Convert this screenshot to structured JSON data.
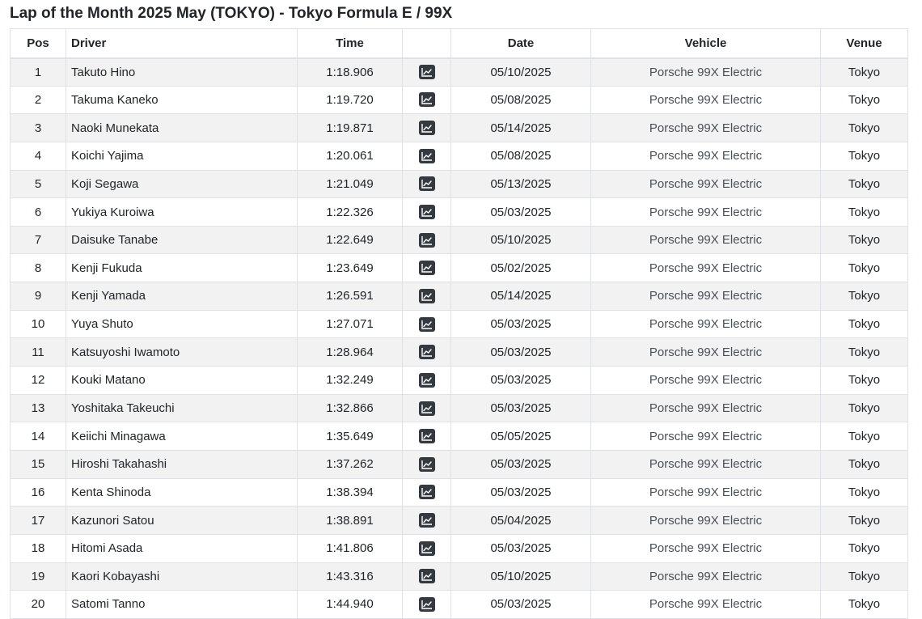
{
  "page": {
    "title": "Lap of the Month 2025 May (TOKYO) - Tokyo Formula E / 99X"
  },
  "table": {
    "headers": {
      "pos": "Pos",
      "driver": "Driver",
      "time": "Time",
      "chart": "",
      "date": "Date",
      "vehicle": "Vehicle",
      "venue": "Venue"
    },
    "rows": [
      {
        "pos": "1",
        "driver": "Takuto Hino",
        "time": "1:18.906",
        "date": "05/10/2025",
        "vehicle": "Porsche 99X Electric",
        "venue": "Tokyo"
      },
      {
        "pos": "2",
        "driver": "Takuma Kaneko",
        "time": "1:19.720",
        "date": "05/08/2025",
        "vehicle": "Porsche 99X Electric",
        "venue": "Tokyo"
      },
      {
        "pos": "3",
        "driver": "Naoki Munekata",
        "time": "1:19.871",
        "date": "05/14/2025",
        "vehicle": "Porsche 99X Electric",
        "venue": "Tokyo"
      },
      {
        "pos": "4",
        "driver": "Koichi Yajima",
        "time": "1:20.061",
        "date": "05/08/2025",
        "vehicle": "Porsche 99X Electric",
        "venue": "Tokyo"
      },
      {
        "pos": "5",
        "driver": "Koji Segawa",
        "time": "1:21.049",
        "date": "05/13/2025",
        "vehicle": "Porsche 99X Electric",
        "venue": "Tokyo"
      },
      {
        "pos": "6",
        "driver": "Yukiya Kuroiwa",
        "time": "1:22.326",
        "date": "05/03/2025",
        "vehicle": "Porsche 99X Electric",
        "venue": "Tokyo"
      },
      {
        "pos": "7",
        "driver": "Daisuke Tanabe",
        "time": "1:22.649",
        "date": "05/10/2025",
        "vehicle": "Porsche 99X Electric",
        "venue": "Tokyo"
      },
      {
        "pos": "8",
        "driver": "Kenji Fukuda",
        "time": "1:23.649",
        "date": "05/02/2025",
        "vehicle": "Porsche 99X Electric",
        "venue": "Tokyo"
      },
      {
        "pos": "9",
        "driver": "Kenji Yamada",
        "time": "1:26.591",
        "date": "05/14/2025",
        "vehicle": "Porsche 99X Electric",
        "venue": "Tokyo"
      },
      {
        "pos": "10",
        "driver": "Yuya Shuto",
        "time": "1:27.071",
        "date": "05/03/2025",
        "vehicle": "Porsche 99X Electric",
        "venue": "Tokyo"
      },
      {
        "pos": "11",
        "driver": "Katsuyoshi Iwamoto",
        "time": "1:28.964",
        "date": "05/03/2025",
        "vehicle": "Porsche 99X Electric",
        "venue": "Tokyo"
      },
      {
        "pos": "12",
        "driver": "Kouki Matano",
        "time": "1:32.249",
        "date": "05/03/2025",
        "vehicle": "Porsche 99X Electric",
        "venue": "Tokyo"
      },
      {
        "pos": "13",
        "driver": "Yoshitaka Takeuchi",
        "time": "1:32.866",
        "date": "05/03/2025",
        "vehicle": "Porsche 99X Electric",
        "venue": "Tokyo"
      },
      {
        "pos": "14",
        "driver": "Keiichi Minagawa",
        "time": "1:35.649",
        "date": "05/05/2025",
        "vehicle": "Porsche 99X Electric",
        "venue": "Tokyo"
      },
      {
        "pos": "15",
        "driver": "Hiroshi Takahashi",
        "time": "1:37.262",
        "date": "05/03/2025",
        "vehicle": "Porsche 99X Electric",
        "venue": "Tokyo"
      },
      {
        "pos": "16",
        "driver": "Kenta Shinoda",
        "time": "1:38.394",
        "date": "05/03/2025",
        "vehicle": "Porsche 99X Electric",
        "venue": "Tokyo"
      },
      {
        "pos": "17",
        "driver": "Kazunori Satou",
        "time": "1:38.891",
        "date": "05/04/2025",
        "vehicle": "Porsche 99X Electric",
        "venue": "Tokyo"
      },
      {
        "pos": "18",
        "driver": "Hitomi Asada",
        "time": "1:41.806",
        "date": "05/03/2025",
        "vehicle": "Porsche 99X Electric",
        "venue": "Tokyo"
      },
      {
        "pos": "19",
        "driver": "Kaori Kobayashi",
        "time": "1:43.316",
        "date": "05/10/2025",
        "vehicle": "Porsche 99X Electric",
        "venue": "Tokyo"
      },
      {
        "pos": "20",
        "driver": "Satomi Tanno",
        "time": "1:44.940",
        "date": "05/03/2025",
        "vehicle": "Porsche 99X Electric",
        "venue": "Tokyo"
      }
    ],
    "row_action_icon": "line-chart-icon"
  },
  "colors": {
    "text": "#212529",
    "vehicle_text": "#495057",
    "stripe": "#f2f2f2",
    "border": "#dee2e6",
    "icon_button": "#343a40"
  }
}
